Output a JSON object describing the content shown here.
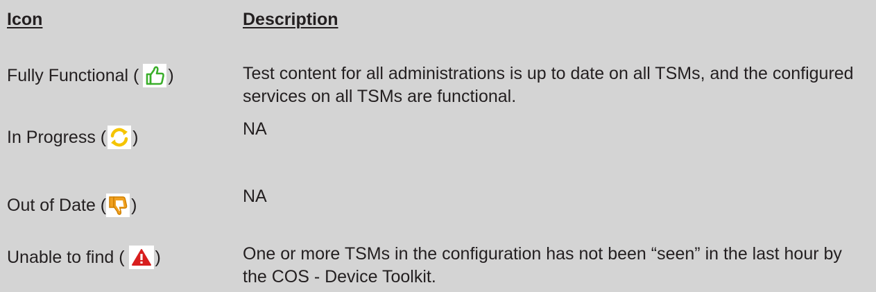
{
  "headers": {
    "icon": "Icon",
    "description": "Description"
  },
  "rows": [
    {
      "label": "Fully Functional (",
      "close": ")",
      "icon": "thumbs-up-icon",
      "icon_color": "#3aae2a",
      "description": "Test content for all administrations is up to date on all TSMs, and the configured services on all TSMs are functional."
    },
    {
      "label": "In Progress (",
      "close": ")",
      "icon": "refresh-icon",
      "icon_color": "#f5c400",
      "description": "NA"
    },
    {
      "label": "Out of Date (",
      "close": ")",
      "icon": "thumbs-down-icon",
      "icon_color": "#f0a020",
      "description": "NA"
    },
    {
      "label": "Unable to find (",
      "close": ")",
      "icon": "warning-icon",
      "icon_color": "#d81e1e",
      "description": "One or more TSMs in the configuration has not been “seen” in the last hour by the COS - Device Toolkit."
    }
  ]
}
